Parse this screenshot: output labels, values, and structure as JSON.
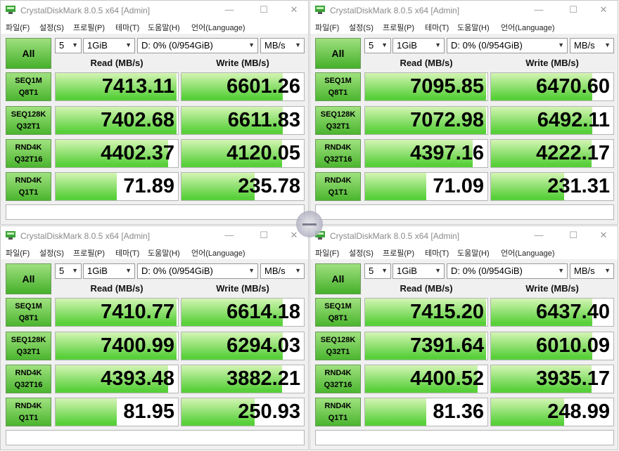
{
  "title": "CrystalDiskMark 8.0.5 x64 [Admin]",
  "window_buttons": {
    "minimize": "—",
    "maximize": "☐",
    "close": "✕"
  },
  "menu": [
    "파일(F)",
    "설정(S)",
    "프로필(P)",
    "테마(T)",
    "도움말(H)",
    "언어(Language)"
  ],
  "all_label": "All",
  "count": "5",
  "size": "1GiB",
  "drive": "D: 0% (0/954GiB)",
  "unit": "MB/s",
  "read_header": "Read (MB/s)",
  "write_header": "Write (MB/s)",
  "tests": [
    {
      "line1": "SEQ1M",
      "line2": "Q8T1"
    },
    {
      "line1": "SEQ128K",
      "line2": "Q32T1"
    },
    {
      "line1": "RND4K",
      "line2": "Q32T16"
    },
    {
      "line1": "RND4K",
      "line2": "Q1T1"
    }
  ],
  "windows": [
    {
      "read": [
        "7413.11",
        "7402.68",
        "4402.37",
        "71.89"
      ],
      "write": [
        "6601.26",
        "6611.83",
        "4120.05",
        "235.78"
      ],
      "read_fill": [
        0.99,
        0.99,
        0.92,
        0.5
      ],
      "write_fill": [
        0.83,
        0.83,
        0.82,
        0.6
      ]
    },
    {
      "read": [
        "7095.85",
        "7072.98",
        "4397.16",
        "71.09"
      ],
      "write": [
        "6470.60",
        "6492.11",
        "4222.17",
        "231.31"
      ],
      "read_fill": [
        0.99,
        0.99,
        0.88,
        0.5
      ],
      "write_fill": [
        0.83,
        0.83,
        0.82,
        0.6
      ]
    },
    {
      "read": [
        "7410.77",
        "7400.99",
        "4393.48",
        "81.95"
      ],
      "write": [
        "6614.18",
        "6294.03",
        "3882.21",
        "250.93"
      ],
      "read_fill": [
        0.99,
        0.99,
        0.92,
        0.5
      ],
      "write_fill": [
        0.83,
        0.83,
        0.82,
        0.6
      ]
    },
    {
      "read": [
        "7415.20",
        "7391.64",
        "4400.52",
        "81.36"
      ],
      "write": [
        "6437.40",
        "6010.09",
        "3935.17",
        "248.99"
      ],
      "read_fill": [
        0.99,
        0.99,
        0.92,
        0.5
      ],
      "write_fill": [
        0.83,
        0.83,
        0.82,
        0.6
      ]
    }
  ]
}
